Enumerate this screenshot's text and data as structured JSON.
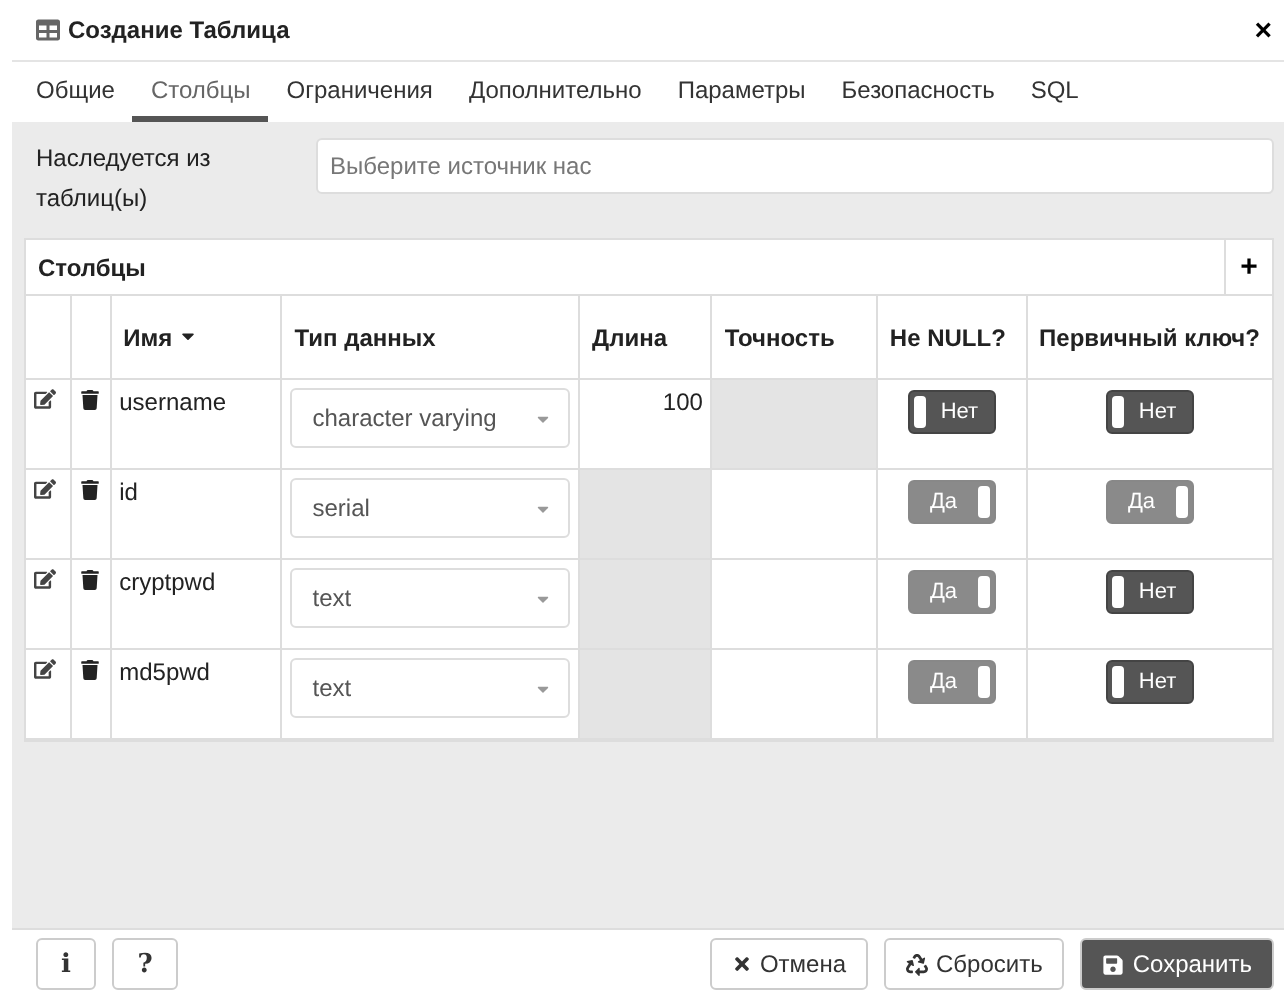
{
  "window": {
    "title": "Создание Таблица",
    "close": "×"
  },
  "tabs": [
    {
      "label": "Общие",
      "selected": false
    },
    {
      "label": "Столбцы",
      "selected": true
    },
    {
      "label": "Ограничения",
      "selected": false
    },
    {
      "label": "Дополнительно",
      "selected": false
    },
    {
      "label": "Параметры",
      "selected": false
    },
    {
      "label": "Безопасность",
      "selected": false
    },
    {
      "label": "SQL",
      "selected": false
    }
  ],
  "inherit": {
    "label": "Наследуется из таблиц(ы)",
    "placeholder": "Выберите источник нас"
  },
  "columns_panel": {
    "title": "Столбцы",
    "add": "+",
    "headers": [
      "Имя",
      "Тип данных",
      "Длина",
      "Точность",
      "Не NULL?",
      "Первичный ключ?"
    ],
    "rows": [
      {
        "name": "username",
        "type": "character varying",
        "length": "100",
        "length_disabled": false,
        "precision_disabled": true,
        "not_null": {
          "on": false,
          "label": "Нет"
        },
        "primary_key": {
          "on": false,
          "label": "Нет"
        }
      },
      {
        "name": "id",
        "type": "serial",
        "length_disabled": true,
        "precision_disabled": false,
        "not_null": {
          "on": true,
          "label": "Да"
        },
        "primary_key": {
          "on": true,
          "label": "Да"
        }
      },
      {
        "name": "cryptpwd",
        "type": "text",
        "length_disabled": true,
        "precision_disabled": false,
        "not_null": {
          "on": true,
          "label": "Да"
        },
        "primary_key": {
          "on": false,
          "label": "Нет"
        }
      },
      {
        "name": "md5pwd",
        "type": "text",
        "length_disabled": true,
        "precision_disabled": false,
        "not_null": {
          "on": true,
          "label": "Да"
        },
        "primary_key": {
          "on": false,
          "label": "Нет"
        }
      }
    ]
  },
  "footer": {
    "info": "i",
    "help": "?",
    "buttons": [
      {
        "label": "Отмена",
        "kind": "cancel"
      },
      {
        "label": "Сбросить",
        "kind": "reset"
      },
      {
        "label": "Сохранить",
        "kind": "save"
      }
    ]
  }
}
